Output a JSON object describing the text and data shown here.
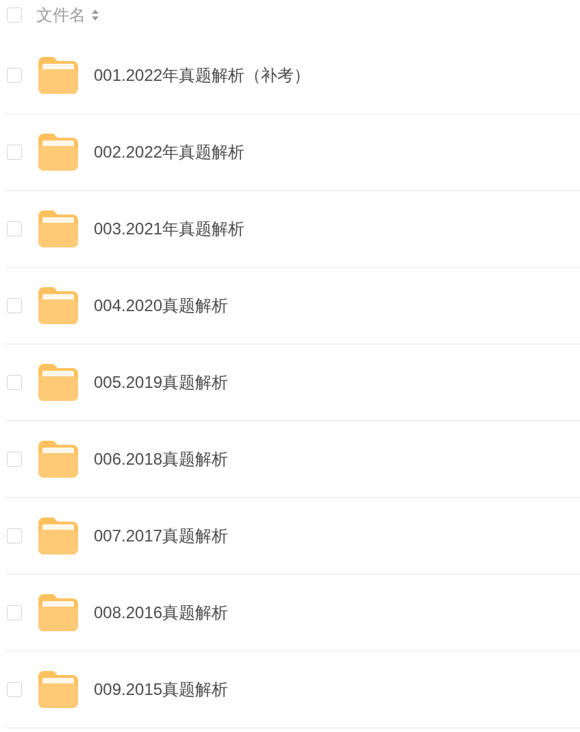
{
  "header": {
    "checked": false,
    "label": "文件名"
  },
  "files": [
    {
      "name": "001.2022年真题解析（补考）",
      "checked": false
    },
    {
      "name": "002.2022年真题解析",
      "checked": false
    },
    {
      "name": "003.2021年真题解析",
      "checked": false
    },
    {
      "name": "004.2020真题解析",
      "checked": false
    },
    {
      "name": "005.2019真题解析",
      "checked": false
    },
    {
      "name": "006.2018真题解析",
      "checked": false
    },
    {
      "name": "007.2017真题解析",
      "checked": false
    },
    {
      "name": "008.2016真题解析",
      "checked": false
    },
    {
      "name": "009.2015真题解析",
      "checked": false
    }
  ]
}
